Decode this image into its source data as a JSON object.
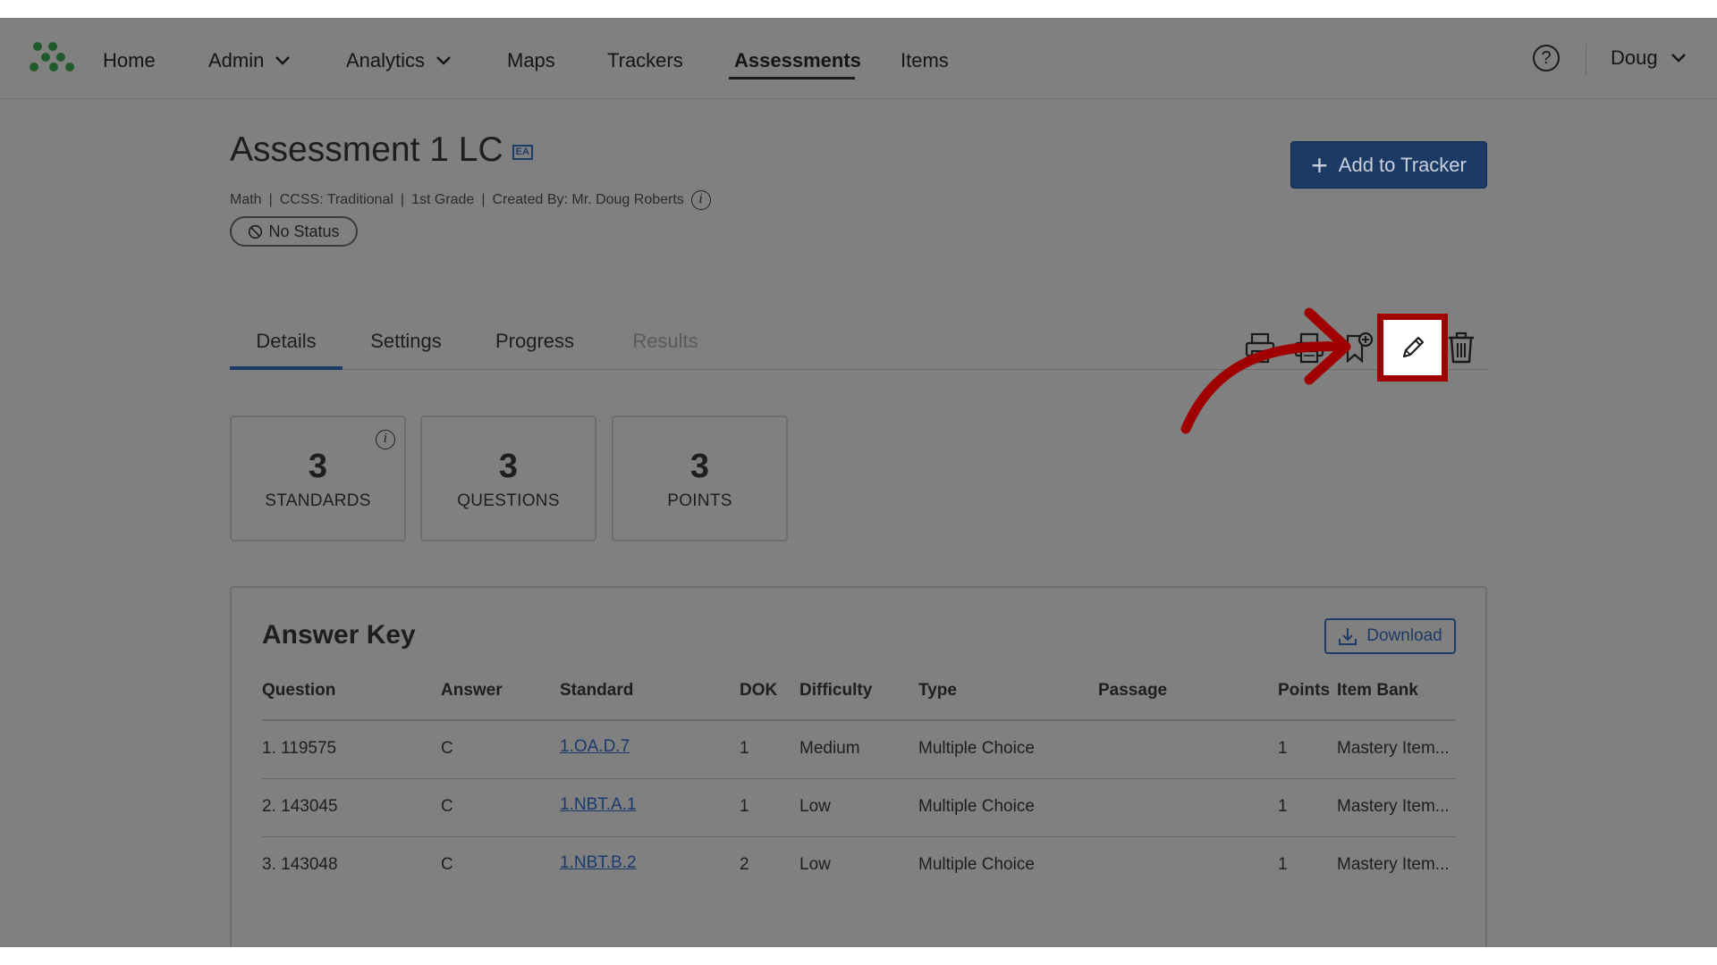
{
  "nav": {
    "items": [
      {
        "label": "Home",
        "dropdown": false
      },
      {
        "label": "Admin",
        "dropdown": true
      },
      {
        "label": "Analytics",
        "dropdown": true
      },
      {
        "label": "Maps",
        "dropdown": false
      },
      {
        "label": "Trackers",
        "dropdown": false
      },
      {
        "label": "Assessments",
        "dropdown": false,
        "active": true
      },
      {
        "label": "Items",
        "dropdown": false
      }
    ],
    "help_icon": "?",
    "user": "Doug"
  },
  "header": {
    "title": "Assessment 1 LC",
    "badge": "EA",
    "meta": [
      "Math",
      "CCSS: Traditional",
      "1st Grade",
      "Created By: Mr. Doug Roberts"
    ],
    "meta_separator": "|",
    "info_glyph": "i",
    "status": "No Status",
    "add_button": "Add to Tracker",
    "add_button_icon": "+"
  },
  "tabs": [
    {
      "label": "Details",
      "active": true,
      "disabled": false
    },
    {
      "label": "Settings",
      "active": false,
      "disabled": false
    },
    {
      "label": "Progress",
      "active": false,
      "disabled": false
    },
    {
      "label": "Results",
      "active": false,
      "disabled": true
    }
  ],
  "toolbar": {
    "icons": [
      "print-icon",
      "print-answer-key-icon",
      "bookmark-add-icon",
      "edit-pencil-icon",
      "trash-icon"
    ],
    "highlighted": "edit-pencil-icon",
    "highlight_color": "#a00000"
  },
  "stats": [
    {
      "value": "3",
      "label": "STANDARDS",
      "info": true
    },
    {
      "value": "3",
      "label": "QUESTIONS",
      "info": false
    },
    {
      "value": "3",
      "label": "POINTS",
      "info": false
    }
  ],
  "answer_key": {
    "title": "Answer Key",
    "download_label": "Download",
    "columns": [
      "Question",
      "Answer",
      "Standard",
      "DOK",
      "Difficulty",
      "Type",
      "Passage",
      "Points",
      "Item Bank"
    ],
    "rows": [
      {
        "question": "1. 119575",
        "answer": "C",
        "standard": "1.OA.D.7",
        "dok": "1",
        "difficulty": "Medium",
        "type": "Multiple Choice",
        "passage": "",
        "points": "1",
        "item_bank": "Mastery Item..."
      },
      {
        "question": "2. 143045",
        "answer": "C",
        "standard": "1.NBT.A.1",
        "dok": "1",
        "difficulty": "Low",
        "type": "Multiple Choice",
        "passage": "",
        "points": "1",
        "item_bank": "Mastery Item..."
      },
      {
        "question": "3. 143048",
        "answer": "C",
        "standard": "1.NBT.B.2",
        "dok": "2",
        "difficulty": "Low",
        "type": "Multiple Choice",
        "passage": "",
        "points": "1",
        "item_bank": "Mastery Item..."
      }
    ]
  },
  "colors": {
    "overlay": "#808080",
    "primary": "#1c3a66",
    "logo_green": "#1f5a2a",
    "annotation_red": "#a00000"
  }
}
